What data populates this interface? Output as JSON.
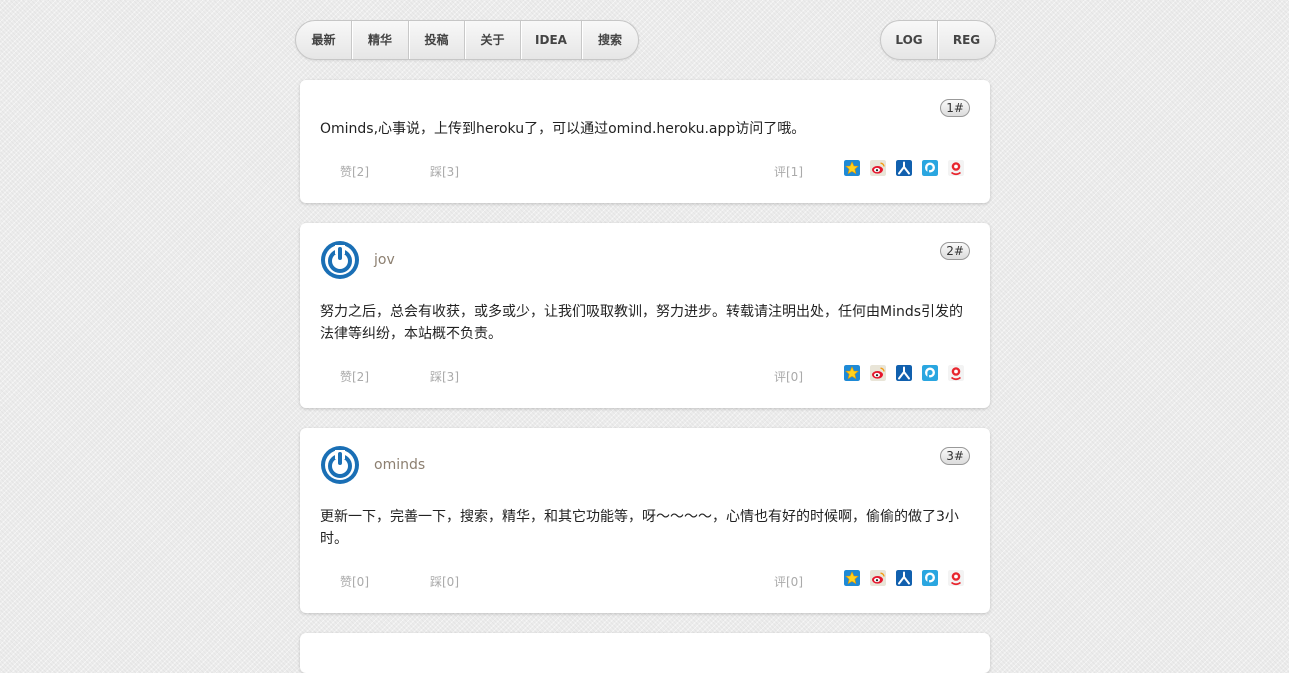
{
  "nav": {
    "left": [
      "最新",
      "精华",
      "投稿",
      "关于",
      "IDEA",
      "搜索"
    ],
    "right": [
      "LOG",
      "REG"
    ]
  },
  "posts": [
    {
      "floor": "1#",
      "content": "Ominds,心事说，上传到heroku了，可以通过omind.heroku.app访问了哦。",
      "like": "赞[2]",
      "dislike": "踩[3]",
      "comment": "评[1]"
    },
    {
      "floor": "2#",
      "author": "jov",
      "content_lines": [
        "努力之后，总会有收获，或多或少，让我们吸取教训，努力进步。转载请注明出处，任何由Minds引发的",
        "法律等纠纷，本站概不负责。"
      ],
      "like": "赞[2]",
      "dislike": "踩[3]",
      "comment": "评[0]"
    },
    {
      "floor": "3#",
      "author": "ominds",
      "content_lines": [
        "更新一下，完善一下，搜索，精华，和其它功能等，呀～～～～，心情也有好的时候啊，偷偷的做了3小",
        "时。"
      ],
      "like": "赞[0]",
      "dislike": "踩[0]",
      "comment": "评[0]"
    }
  ],
  "share_icons": [
    "qzone-icon",
    "weibo-icon",
    "renren-icon",
    "pengyou-icon",
    "kaixin-icon"
  ],
  "colors": {
    "avatar": "#1a6fb5",
    "username": "#8c7f70",
    "action": "#aaaaaa"
  }
}
